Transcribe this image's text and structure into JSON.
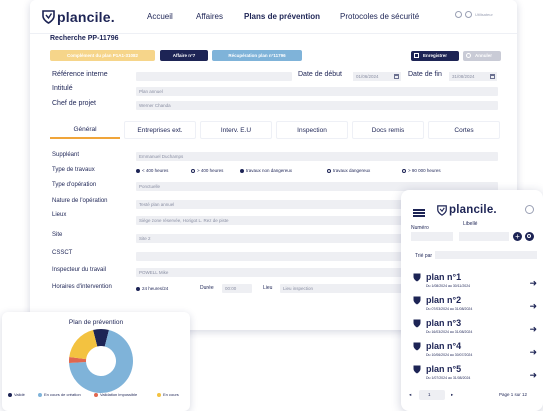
{
  "header": {
    "brand": "plancile.",
    "nav": [
      "Accueil",
      "Affaires",
      "Plans de prévention",
      "Protocoles de sécurité"
    ],
    "user_label": "Utilisateur"
  },
  "record": {
    "search_label": "Recherche",
    "search_value": "PP-11796",
    "tags": [
      "Complément du plan P1A1-31082",
      "Affaire n°7",
      "Récupération plan n°11796"
    ],
    "save_label": "Enregistrer",
    "second_label": "Annuler"
  },
  "form": {
    "ref_label": "Référence interne",
    "title_label": "Intitulé",
    "title_value": "Plan annuel",
    "manager_label": "Chef de projet",
    "manager_value": "Werner Chanda",
    "start_label": "Date de début",
    "start_value": "01/06/2024",
    "end_label": "Date de fin",
    "end_value": "31/08/2024"
  },
  "tabs": [
    "Général",
    "Entreprises ext.",
    "Interv. E.U",
    "Inspection",
    "Docs remis",
    "Cortes"
  ],
  "general": {
    "supplier_label": "Suppléant",
    "supplier_value": "Emmanuel Duchamps",
    "worktype_label": "Type de travaux",
    "worktype_options": [
      "< 400 heures",
      "> 400 heures",
      "travaux non dangereux",
      "travaux dangereux",
      "> 90 000 heures"
    ],
    "optype_label": "Type d'opération",
    "optype_value": "Ponctuelle",
    "nature_label": "Nature de l'opération",
    "nature_value": "Testé plan annuel",
    "places_label": "Lieux",
    "places_value": "Siège zone réservée, Horigot L. Rez de piste",
    "site_label": "Site",
    "site_value": "Site 2",
    "cssct_label": "CSSCT",
    "inspector_label": "Inspecteur du travail",
    "inspector_value": "POWELL Mike",
    "hours_label": "Horaires d'intervention",
    "hours_value": "24 heures/24",
    "duration_label": "Durée",
    "duration_value": "00:00",
    "place_label": "Lieu",
    "place_value": "Lieu inspection"
  },
  "pie_card": {
    "title": "Plan de prévention",
    "legend": [
      "Validé",
      "En cours de création",
      "Validation impossible",
      "En cours"
    ]
  },
  "chart_data": {
    "type": "pie",
    "title": "Plan de prévention",
    "categories": [
      "Validé",
      "En cours de création",
      "Validation impossible",
      "En cours"
    ],
    "values": [
      8,
      70,
      3,
      19
    ],
    "colors": [
      "#1d2455",
      "#7fb3d9",
      "#e0674f",
      "#f3c240"
    ]
  },
  "mobile": {
    "brand": "plancile.",
    "numero_label": "Numéro",
    "libelle_label": "Libellé",
    "sort_label": "Trié par",
    "plans": [
      {
        "title": "plan n°1",
        "dates": "Du 1/08/2024 au 30/11/2024"
      },
      {
        "title": "plan n°2",
        "dates": "Du 07/03/2024 au 31/08/2024"
      },
      {
        "title": "plan n°3",
        "dates": "Du 16/03/2024 au 31/08/2024"
      },
      {
        "title": "plan n°4",
        "dates": "Du 10/06/2024 au 30/07/2024"
      },
      {
        "title": "plan n°5",
        "dates": "Du 1/07/2024 au 31/08/2024"
      }
    ],
    "page_value": "1",
    "page_info": "Page 1 sur 12"
  },
  "colors": {
    "navy": "#1d2455",
    "yellow": "#f6d58a",
    "accent": "#f0a53a",
    "blue": "#7fb3d9"
  }
}
